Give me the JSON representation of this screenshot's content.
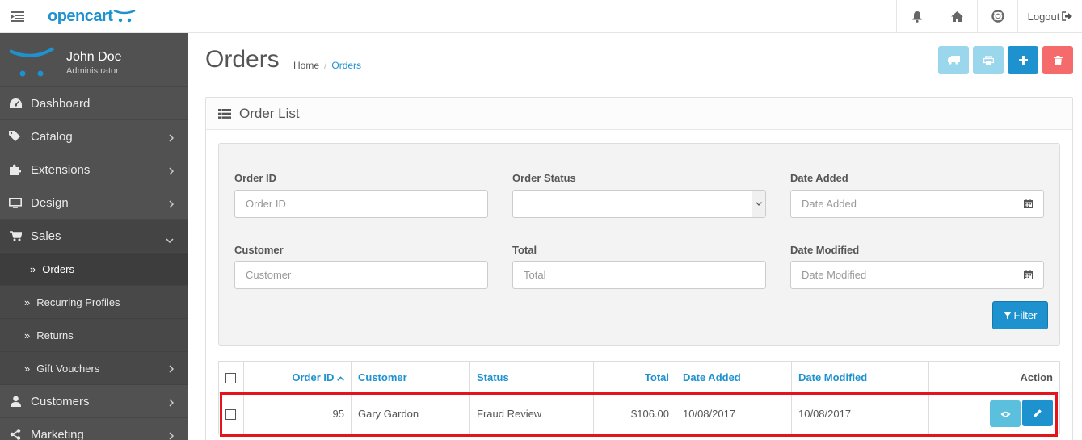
{
  "header": {
    "logo": "opencart",
    "logout": "Logout"
  },
  "profile": {
    "name": "John Doe",
    "role": "Administrator"
  },
  "sidebar": {
    "items": [
      {
        "label": "Dashboard",
        "icon": "dashboard-icon"
      },
      {
        "label": "Catalog",
        "icon": "tags-icon"
      },
      {
        "label": "Extensions",
        "icon": "puzzle-icon"
      },
      {
        "label": "Design",
        "icon": "monitor-icon"
      },
      {
        "label": "Sales",
        "icon": "cart-icon"
      },
      {
        "label": "Customers",
        "icon": "user-icon"
      },
      {
        "label": "Marketing",
        "icon": "share-icon"
      }
    ],
    "sales_sub": [
      {
        "label": "Orders"
      },
      {
        "label": "Recurring Profiles"
      },
      {
        "label": "Returns"
      },
      {
        "label": "Gift Vouchers"
      }
    ]
  },
  "page": {
    "title": "Orders",
    "breadcrumb": {
      "home": "Home",
      "sep": "/",
      "current": "Orders"
    }
  },
  "panel": {
    "title": "Order List"
  },
  "filter": {
    "order_id": {
      "label": "Order ID",
      "placeholder": "Order ID"
    },
    "order_status": {
      "label": "Order Status",
      "value": ""
    },
    "date_added": {
      "label": "Date Added",
      "placeholder": "Date Added"
    },
    "customer": {
      "label": "Customer",
      "placeholder": "Customer"
    },
    "total": {
      "label": "Total",
      "placeholder": "Total"
    },
    "date_modified": {
      "label": "Date Modified",
      "placeholder": "Date Modified"
    },
    "button": "Filter"
  },
  "table": {
    "headers": {
      "order_id": "Order ID",
      "customer": "Customer",
      "status": "Status",
      "total": "Total",
      "date_added": "Date Added",
      "date_modified": "Date Modified",
      "action": "Action"
    },
    "rows": [
      {
        "order_id": "95",
        "customer": "Gary Gardon",
        "status": "Fraud Review",
        "total": "$106.00",
        "date_added": "10/08/2017",
        "date_modified": "10/08/2017"
      }
    ]
  },
  "colors": {
    "primary": "#1e91cf",
    "info": "#5bc0de",
    "danger": "#f56b6b",
    "sidebar": "#515151",
    "highlight": "#e3151b"
  }
}
